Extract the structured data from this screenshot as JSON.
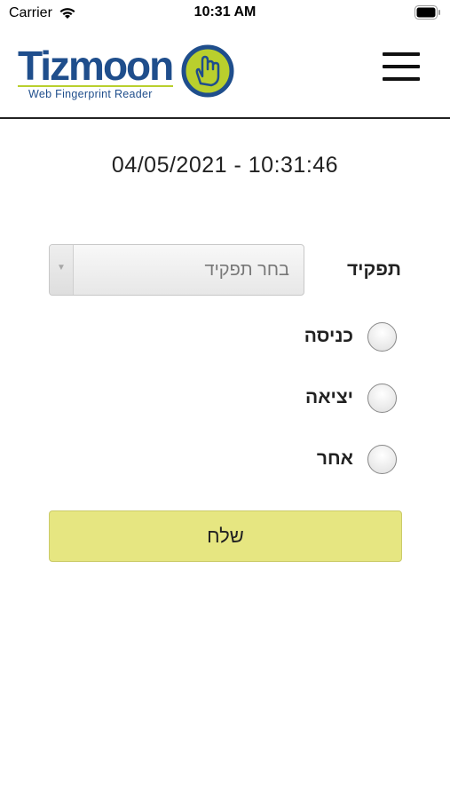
{
  "status_bar": {
    "carrier": "Carrier",
    "time": "10:31 AM"
  },
  "header": {
    "logo_word": "Tizmoon",
    "logo_subtitle": "Web Fingerprint Reader",
    "menu_icon": "hamburger-icon"
  },
  "main": {
    "timestamp": "04/05/2021 - 10:31:46",
    "role": {
      "label": "תפקיד",
      "select_value": "בחר תפקיד"
    },
    "options": [
      {
        "label": "כניסה"
      },
      {
        "label": "יציאה"
      },
      {
        "label": "אחר"
      }
    ],
    "submit_label": "שלח"
  },
  "colors": {
    "brand_blue": "#1f4e8c",
    "brand_green": "#b9cf2d",
    "submit_bg": "#e6e681"
  }
}
